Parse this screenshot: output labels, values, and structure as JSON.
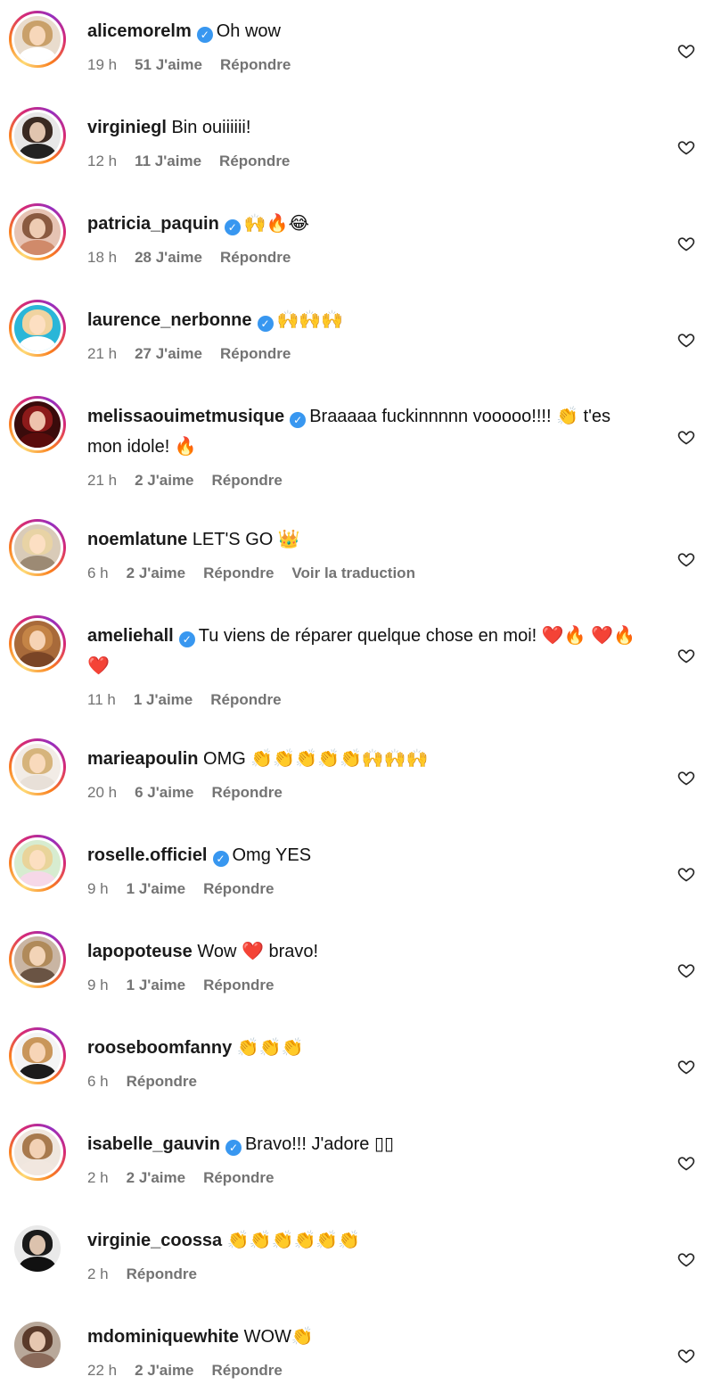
{
  "ui": {
    "like_icon": "heart-outline-icon",
    "verified_icon": "verified-badge-icon",
    "ring_colors": [
      "#feda75",
      "#fa7e1e",
      "#d62976",
      "#962fbf"
    ]
  },
  "comments": [
    {
      "username": "alicemorelm",
      "verified": true,
      "text": "Oh wow",
      "time": "19 h",
      "likes": "51 J'aime",
      "reply": "Répondre",
      "avatar": {
        "bg": "#e9dccd",
        "hair": "#c9a06a",
        "body": "#ffffff"
      }
    },
    {
      "username": "virginiegl",
      "verified": false,
      "text": "Bin ouiiiiii!",
      "time": "12 h",
      "likes": "11 J'aime",
      "reply": "Répondre",
      "avatar": {
        "bg": "#e7e7e7",
        "hair": "#3a2a22",
        "body": "#222222"
      }
    },
    {
      "username": "patricia_paquin",
      "verified": true,
      "text": "🙌🔥😂",
      "time": "18 h",
      "likes": "28 J'aime",
      "reply": "Répondre",
      "avatar": {
        "bg": "#e6c3b3",
        "hair": "#8a5a40",
        "body": "#d08a6a"
      }
    },
    {
      "username": "laurence_nerbonne",
      "verified": true,
      "text": "🙌🙌🙌",
      "time": "21 h",
      "likes": "27 J'aime",
      "reply": "Répondre",
      "avatar": {
        "bg": "#2ab6d8",
        "hair": "#f0d3a0",
        "body": "#ffffff"
      }
    },
    {
      "username": "melissaouimetmusique",
      "verified": true,
      "text": "Braaaaa fuckinnnnn vooooo!!!! 👏 t'es mon idole! 🔥",
      "time": "21 h",
      "likes": "2 J'aime",
      "reply": "Répondre",
      "avatar": {
        "bg": "#3a0b0b",
        "hair": "#8c1a1a",
        "body": "#5a0c0c"
      }
    },
    {
      "username": "noemlatune",
      "verified": false,
      "text": "LET'S GO 👑",
      "time": "6 h",
      "likes": "2 J'aime",
      "reply": "Répondre",
      "translate": "Voir la traduction",
      "avatar": {
        "bg": "#d9cbb8",
        "hair": "#e8d3a5",
        "body": "#9c8a74"
      }
    },
    {
      "username": "ameliehall",
      "verified": true,
      "text": "Tu viens de réparer quelque chose en moi! ❤️🔥 ❤️🔥❤️",
      "time": "11 h",
      "likes": "1 J'aime",
      "reply": "Répondre",
      "avatar": {
        "bg": "#a86a3a",
        "hair": "#c48446",
        "body": "#7a4526"
      }
    },
    {
      "username": "marieapoulin",
      "verified": false,
      "text": "OMG 👏👏👏👏👏🙌🙌🙌",
      "time": "20 h",
      "likes": "6 J'aime",
      "reply": "Répondre",
      "avatar": {
        "bg": "#f2ece6",
        "hair": "#d6b47c",
        "body": "#e8e0d8"
      }
    },
    {
      "username": "roselle.officiel",
      "verified": true,
      "text": "Omg YES",
      "time": "9 h",
      "likes": "1 J'aime",
      "reply": "Répondre",
      "avatar": {
        "bg": "#d7ecd0",
        "hair": "#e9d49a",
        "body": "#f6d8e8"
      }
    },
    {
      "username": "lapopoteuse",
      "verified": false,
      "text": "Wow ❤️ bravo!",
      "time": "9 h",
      "likes": "1 J'aime",
      "reply": "Répondre",
      "avatar": {
        "bg": "#c9b5a3",
        "hair": "#b08a5a",
        "body": "#6a5444"
      }
    },
    {
      "username": "rooseboomfanny",
      "verified": false,
      "text": "👏👏👏",
      "time": "6 h",
      "likes": "",
      "reply": "Répondre",
      "avatar": {
        "bg": "#f4f4f4",
        "hair": "#c9965a",
        "body": "#1c1c1c"
      }
    },
    {
      "username": "isabelle_gauvin",
      "verified": true,
      "text": "Bravo!!! J'adore ▯▯",
      "time": "2 h",
      "likes": "2 J'aime",
      "reply": "Répondre",
      "avatar": {
        "bg": "#efe6de",
        "hair": "#a87a4e",
        "body": "#f1e7df"
      }
    },
    {
      "username": "virginie_coossa",
      "verified": false,
      "text": "👏👏👏👏👏👏",
      "time": "2 h",
      "likes": "",
      "reply": "Répondre",
      "no_ring": true,
      "avatar": {
        "bg": "#e9e9e9",
        "hair": "#1a1a1a",
        "body": "#111111"
      }
    },
    {
      "username": "mdominiquewhite",
      "verified": false,
      "text": "WOW👏",
      "time": "22 h",
      "likes": "2 J'aime",
      "reply": "Répondre",
      "no_ring": true,
      "avatar": {
        "bg": "#b8a89a",
        "hair": "#5a3a2a",
        "body": "#8a6a5a"
      }
    }
  ]
}
